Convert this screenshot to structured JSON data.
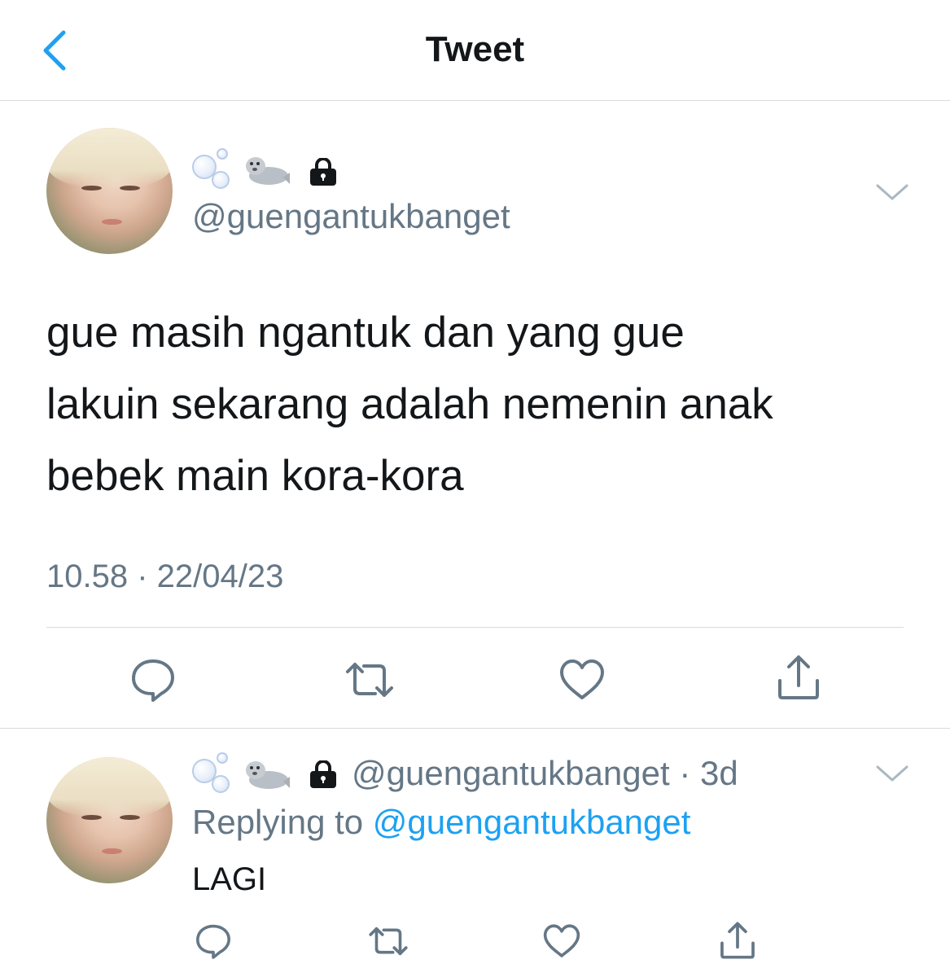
{
  "header": {
    "title": "Tweet",
    "accent_color": "#1da1f2"
  },
  "tweet": {
    "author_handle": "@guengantukbanget",
    "display_name_icons": [
      "bubbles-icon",
      "seal-icon",
      "lock-icon"
    ],
    "lines": [
      "gue masih ngantuk dan yang gue",
      "lakuin sekarang adalah nemenin anak",
      "bebek main kora-kora"
    ],
    "meta": "10.58 · 22/04/23"
  },
  "reply": {
    "author_handle": "@guengantukbanget",
    "time": "· 3d",
    "replying_to_label": "Replying to",
    "replying_to_handle": "@guengantukbanget",
    "text": "LAGI"
  },
  "actions": [
    "reply-icon",
    "retweet-icon",
    "like-icon",
    "share-icon"
  ]
}
